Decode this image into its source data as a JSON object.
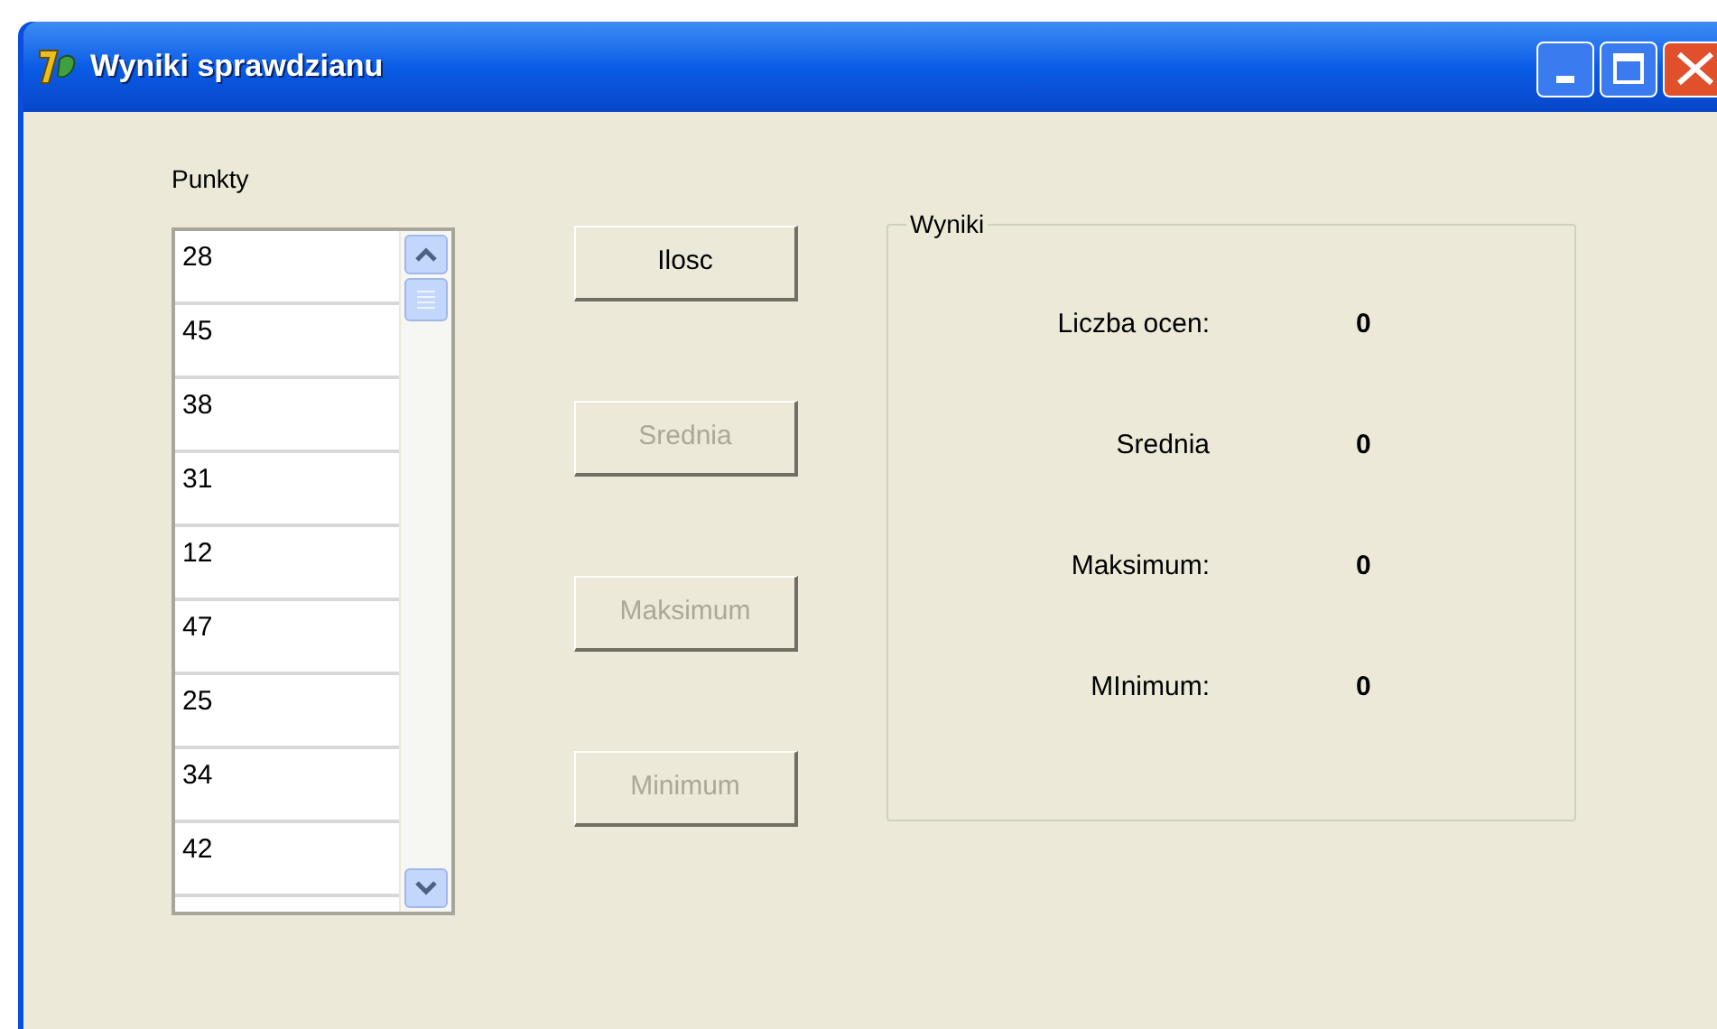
{
  "window": {
    "title": "Wyniki sprawdzianu"
  },
  "points": {
    "label": "Punkty",
    "items": [
      "28",
      "45",
      "38",
      "31",
      "12",
      "47",
      "25",
      "34",
      "42"
    ]
  },
  "buttons": [
    {
      "label": "Ilosc",
      "disabled": false
    },
    {
      "label": "Srednia",
      "disabled": true
    },
    {
      "label": "Maksimum",
      "disabled": true
    },
    {
      "label": "Minimum",
      "disabled": true
    }
  ],
  "results": {
    "title": "Wyniki",
    "rows": [
      {
        "label": "Liczba ocen:",
        "value": "0"
      },
      {
        "label": "Srednia",
        "value": "0"
      },
      {
        "label": "Maksimum:",
        "value": "0"
      },
      {
        "label": "MInimum:",
        "value": "0"
      }
    ]
  }
}
